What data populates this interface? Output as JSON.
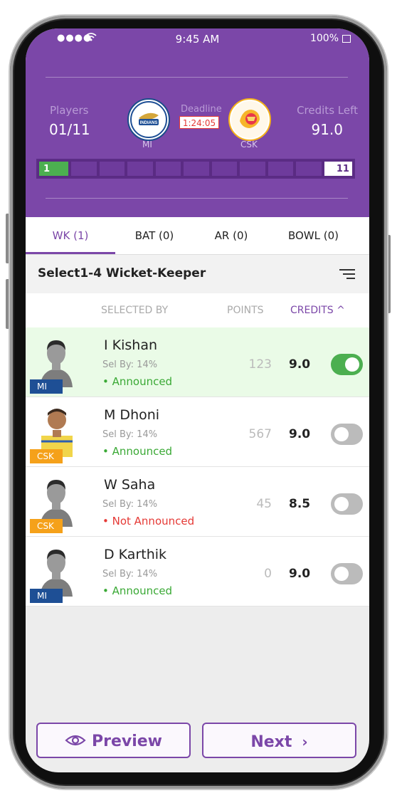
{
  "status": {
    "time": "9:45 AM",
    "battery": "100%"
  },
  "header": {
    "players_label": "Players",
    "players_value": "01/11",
    "credits_label": "Credits Left",
    "credits_value": "91.0",
    "deadline_label": "Deadline",
    "deadline_value": "1:24:05",
    "team_left": "MI",
    "team_right": "CSK",
    "progress_first": "1",
    "progress_last": "11",
    "progress_selected": 1,
    "progress_total": 11
  },
  "tabs": [
    {
      "label": "WK (1)"
    },
    {
      "label": "BAT (0)"
    },
    {
      "label": "AR (0)"
    },
    {
      "label": "BOWL (0)"
    }
  ],
  "section": {
    "title": "Select1-4 Wicket-Keeper"
  },
  "columns": {
    "selected_by": "SELECTED BY",
    "points": "POINTS",
    "credits": "CREDITS ^"
  },
  "players": [
    {
      "name": "I Kishan",
      "sel_by": "Sel By: 14%",
      "status": "• Announced",
      "points": "123",
      "credits": "9.0",
      "team": "MI",
      "selected": true
    },
    {
      "name": "M Dhoni",
      "sel_by": "Sel By: 14%",
      "status": "• Announced",
      "points": "567",
      "credits": "9.0",
      "team": "CSK",
      "selected": false
    },
    {
      "name": "W Saha",
      "sel_by": "Sel By: 14%",
      "status": "• Not Announced",
      "points": "45",
      "credits": "8.5",
      "team": "CSK",
      "selected": false
    },
    {
      "name": "D Karthik",
      "sel_by": "Sel By: 14%",
      "status": "• Announced",
      "points": "0",
      "credits": "9.0",
      "team": "MI",
      "selected": false
    }
  ],
  "footer": {
    "preview_label": "Preview",
    "next_label": "Next"
  },
  "colors": {
    "accent": "#7b47a8",
    "announced": "#3aa935",
    "not_announced": "#e53935",
    "mi": "#1e4f95",
    "csk": "#f5a11a"
  }
}
